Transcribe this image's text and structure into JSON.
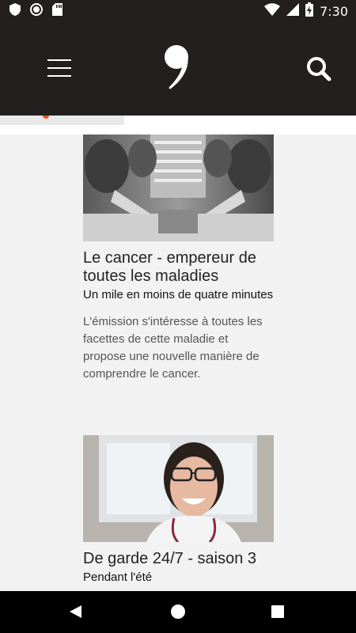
{
  "status_bar": {
    "time": "7:30",
    "icons": [
      "shield-icon",
      "circle-record-icon",
      "sd-card-icon",
      "wifi-icon",
      "signal-icon",
      "battery-charging-icon"
    ]
  },
  "app_bar": {
    "icons": [
      "hamburger-menu-icon",
      "comma-logo-icon",
      "search-icon"
    ]
  },
  "articles": [
    {
      "title": "Le cancer - empereur de toutes les maladies",
      "subtitle": "Un mile en moins de quatre minutes",
      "description": "L'émission s'intéresse à toutes les facettes de cette maladie et propose une nouvelle manière de comprendre le cancer."
    },
    {
      "title": "De garde 24/7 - saison 3",
      "subtitle": "Pendant l'été"
    }
  ],
  "nav_bar": {
    "icons": [
      "back-icon",
      "home-icon",
      "recents-icon"
    ]
  },
  "colors": {
    "header_bg": "#231f1f",
    "page_bg": "#f2f2f2",
    "accent": "#e05a1a"
  }
}
